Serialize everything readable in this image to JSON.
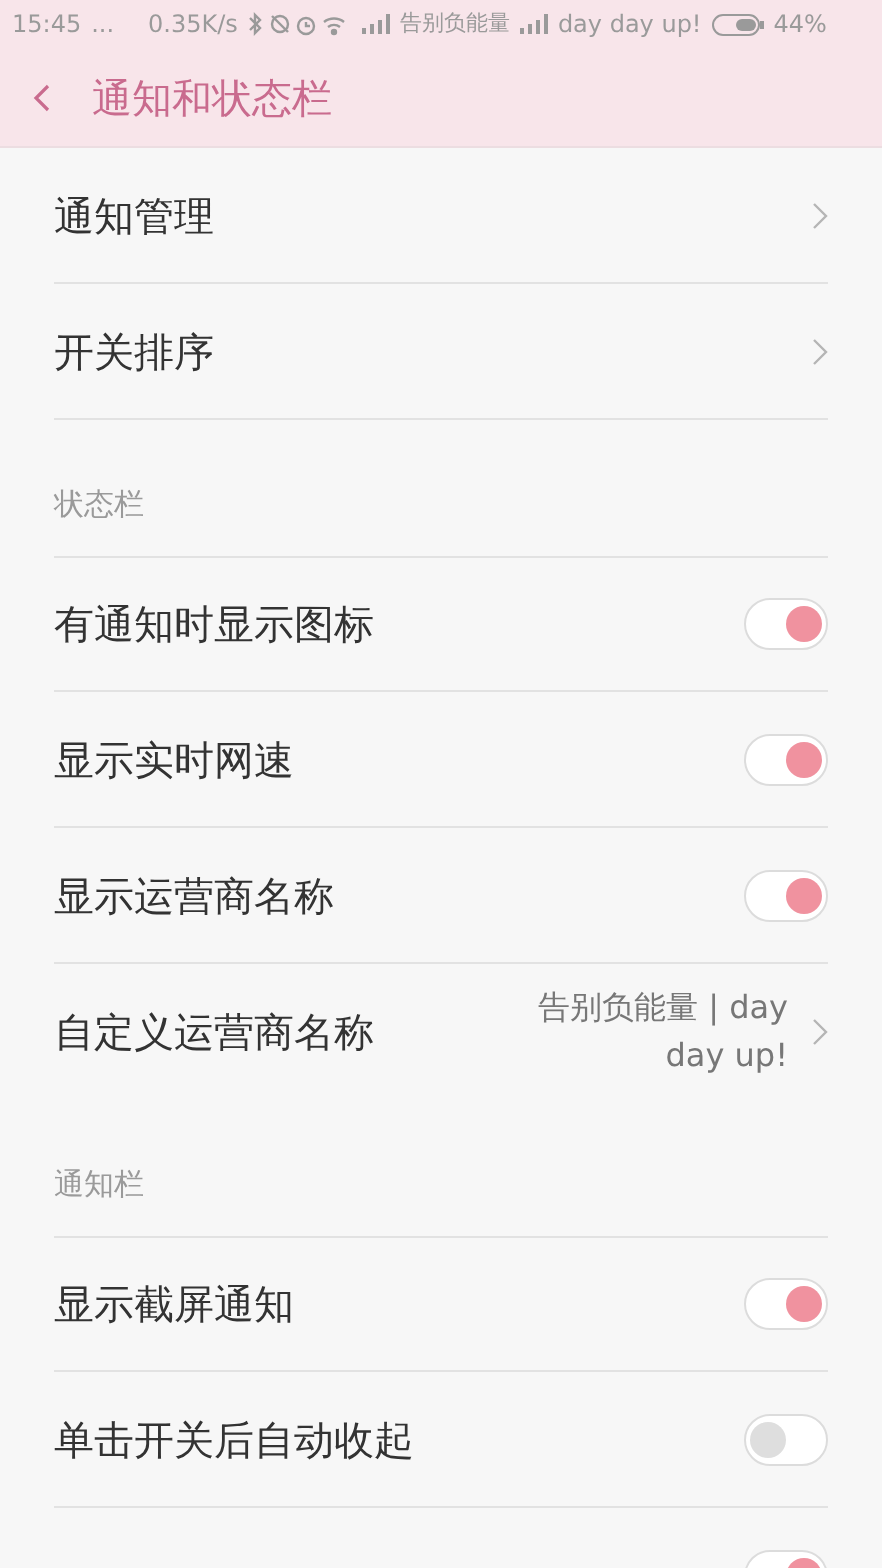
{
  "status_bar": {
    "time": "15:45",
    "dots": "...",
    "speed": "0.35K/s",
    "carrier_1": "告别负能量",
    "carrier_2": "day day up!",
    "battery_percent": "44%"
  },
  "header": {
    "title": "通知和状态栏"
  },
  "sections": [
    {
      "items": [
        {
          "kind": "link",
          "label": "通知管理"
        },
        {
          "kind": "link",
          "label": "开关排序"
        }
      ]
    },
    {
      "title": "状态栏",
      "items": [
        {
          "kind": "toggle",
          "label": "有通知时显示图标",
          "on": true
        },
        {
          "kind": "toggle",
          "label": "显示实时网速",
          "on": true
        },
        {
          "kind": "toggle",
          "label": "显示运营商名称",
          "on": true
        },
        {
          "kind": "link",
          "label": "自定义运营商名称",
          "value": "告别负能量 | day day up!"
        }
      ]
    },
    {
      "title": "通知栏",
      "items": [
        {
          "kind": "toggle",
          "label": "显示截屏通知",
          "on": true
        },
        {
          "kind": "toggle",
          "label": "单击开关后自动收起",
          "on": false
        },
        {
          "kind": "toggle",
          "on": true
        }
      ]
    }
  ]
}
